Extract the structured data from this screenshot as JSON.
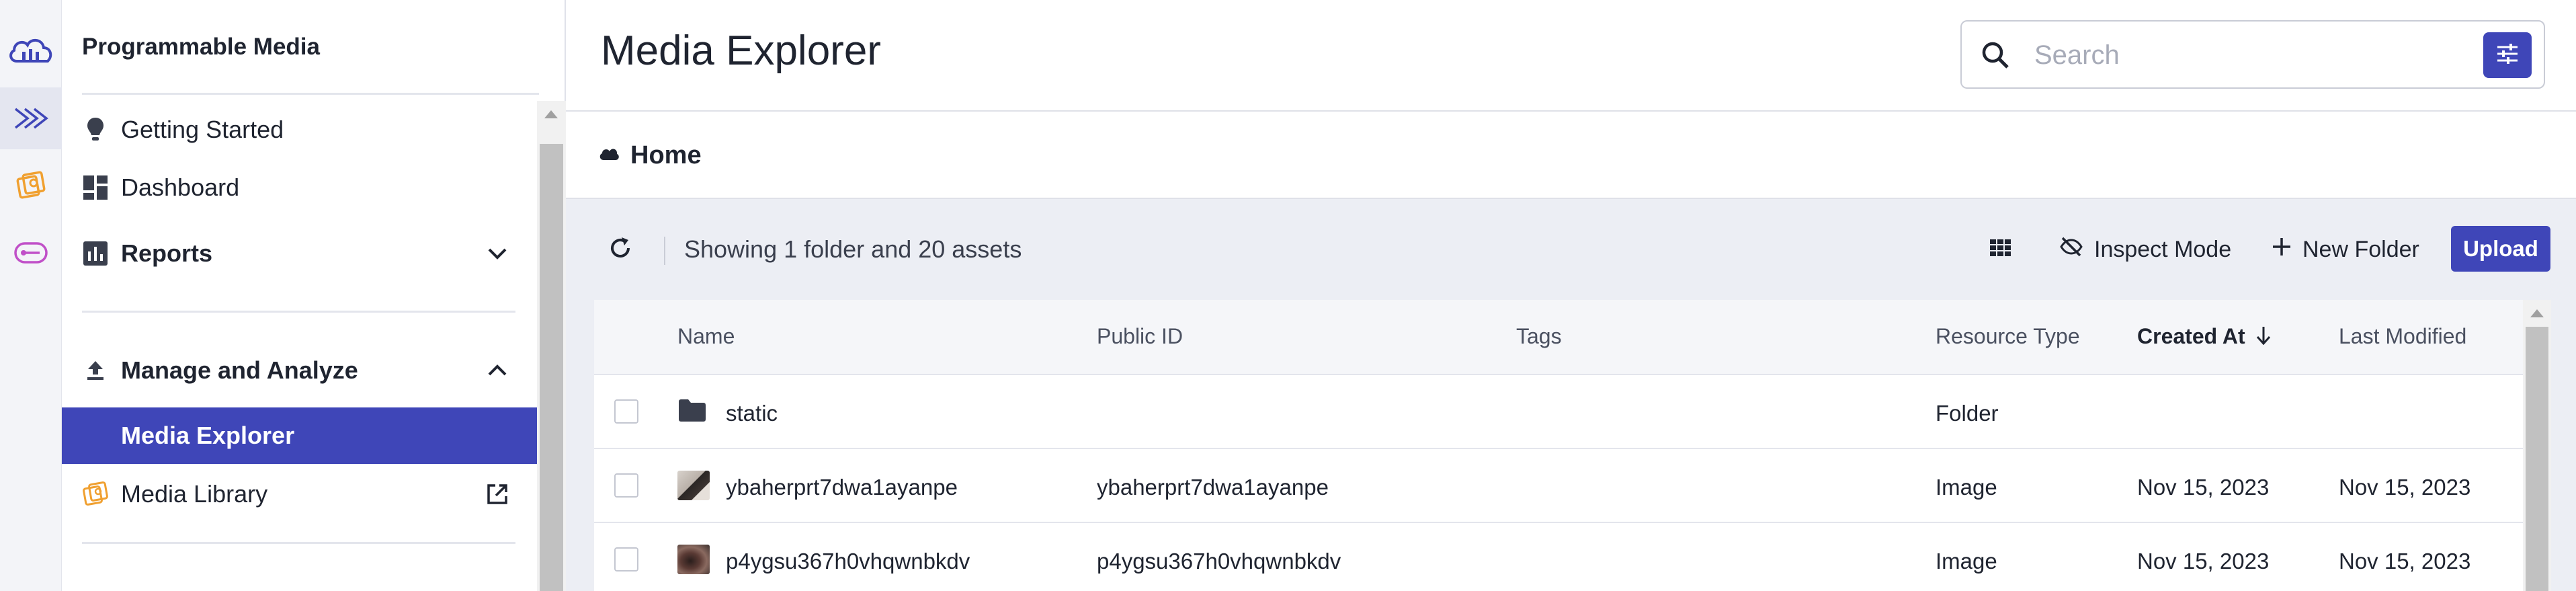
{
  "rail": {
    "icons": [
      "cloudinary-logo-icon",
      "programmable-media-icon",
      "assets-icon",
      "video-icon"
    ]
  },
  "sidebar": {
    "title": "Programmable Media",
    "items": [
      {
        "label": "Getting Started",
        "icon": "lightbulb-icon"
      },
      {
        "label": "Dashboard",
        "icon": "dashboard-icon"
      },
      {
        "label": "Reports",
        "icon": "reports-icon"
      },
      {
        "label": "Manage and Analyze",
        "icon": "upload-icon"
      },
      {
        "label": "Media Explorer"
      },
      {
        "label": "Media Library",
        "icon": "media-library-icon"
      }
    ]
  },
  "header": {
    "title": "Media Explorer",
    "search_placeholder": "Search"
  },
  "breadcrumb": {
    "label": "Home"
  },
  "toolbar": {
    "showing": "Showing 1 folder and 20 assets",
    "inspect_mode": "Inspect Mode",
    "new_folder": "New Folder",
    "upload": "Upload"
  },
  "table": {
    "columns": [
      "Name",
      "Public ID",
      "Tags",
      "Resource Type",
      "Created At",
      "Last Modified"
    ],
    "rows": [
      {
        "name": "static",
        "public_id": "",
        "tags": "",
        "resource_type": "Folder",
        "created_at": "",
        "last_modified": ""
      },
      {
        "name": "ybaherprt7dwa1ayanpe",
        "public_id": "ybaherprt7dwa1ayanpe",
        "tags": "",
        "resource_type": "Image",
        "created_at": "Nov 15, 2023",
        "last_modified": "Nov 15, 2023"
      },
      {
        "name": "p4ygsu367h0vhqwnbkdv",
        "public_id": "p4ygsu367h0vhqwnbkdv",
        "tags": "",
        "resource_type": "Image",
        "created_at": "Nov 15, 2023",
        "last_modified": "Nov 15, 2023"
      }
    ]
  },
  "colors": {
    "accent": "#3f46b8",
    "content_bg": "#eceef4"
  }
}
